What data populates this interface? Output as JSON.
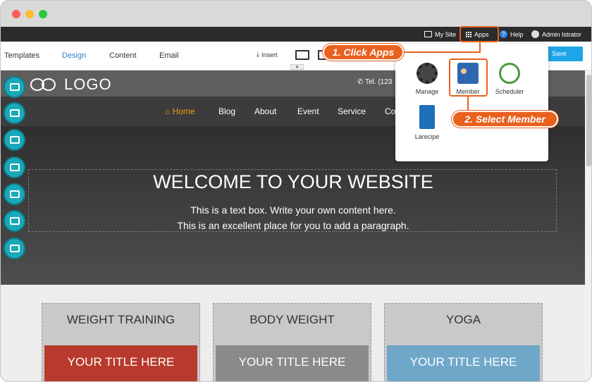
{
  "admin_bar": {
    "my_site": "My Site",
    "apps": "Apps",
    "help": "Help",
    "user": "Admin Istrator"
  },
  "toolbar": {
    "tabs": [
      "Templates",
      "Design",
      "Content",
      "Email"
    ],
    "active_tab": "Design",
    "insert": "Insert",
    "save": "Save"
  },
  "site": {
    "logo": "LOGO",
    "tel": "Tel. (123",
    "nav": [
      "Home",
      "Blog",
      "About",
      "Event",
      "Service",
      "Co"
    ],
    "hero_title": "WELCOME TO YOUR WEBSITE",
    "hero_line1": "This is a text box. Write your own content here.",
    "hero_line2": "This is an excellent place for you to add a paragraph.",
    "cards": [
      {
        "title": "WEIGHT TRAINING",
        "image_title": "YOUR TITLE HERE",
        "color": "#b83a2c"
      },
      {
        "title": "BODY WEIGHT",
        "image_title": "YOUR TITLE HERE",
        "color": "#8a8a8a"
      },
      {
        "title": "YOGA",
        "image_title": "YOUR TITLE HERE",
        "color": "#6fa7c9"
      }
    ]
  },
  "apps_panel": {
    "items": [
      "Manage",
      "Member",
      "Scheduler",
      "Larecipe"
    ]
  },
  "annotations": {
    "step1": "1. Click Apps",
    "step2": "2. Select Member"
  },
  "colors": {
    "accent": "#e8611e",
    "save": "#1ea5e9",
    "sidebar": "#1aa9b8",
    "nav_active": "#f39c12"
  }
}
